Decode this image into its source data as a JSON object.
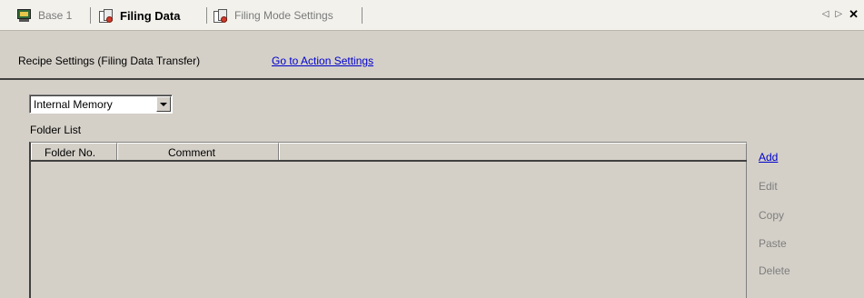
{
  "tabs": [
    {
      "label": "Base 1",
      "icon": "screen-icon",
      "active": false
    },
    {
      "label": "Filing Data",
      "icon": "filing-data-icon",
      "active": true
    },
    {
      "label": "Filing Mode Settings",
      "icon": "filing-data-icon",
      "active": false
    }
  ],
  "tab_nav": {
    "prev": "◁",
    "next": "▷",
    "close": "✕"
  },
  "header": {
    "title": "Recipe Settings (Filing Data Transfer)",
    "action_link": "Go to Action Settings"
  },
  "storage": {
    "selected": "Internal Memory"
  },
  "folder_list": {
    "label": "Folder List",
    "columns": [
      "Folder No.",
      "Comment"
    ],
    "rows": []
  },
  "actions": [
    {
      "label": "Add",
      "enabled": true
    },
    {
      "label": "Edit",
      "enabled": false
    },
    {
      "label": "Copy",
      "enabled": false
    },
    {
      "label": "Paste",
      "enabled": false
    },
    {
      "label": "Delete",
      "enabled": false
    }
  ],
  "colors": {
    "link": "#0000cc",
    "background": "#d4d0c8",
    "disabled_text": "#7e7e7e"
  }
}
